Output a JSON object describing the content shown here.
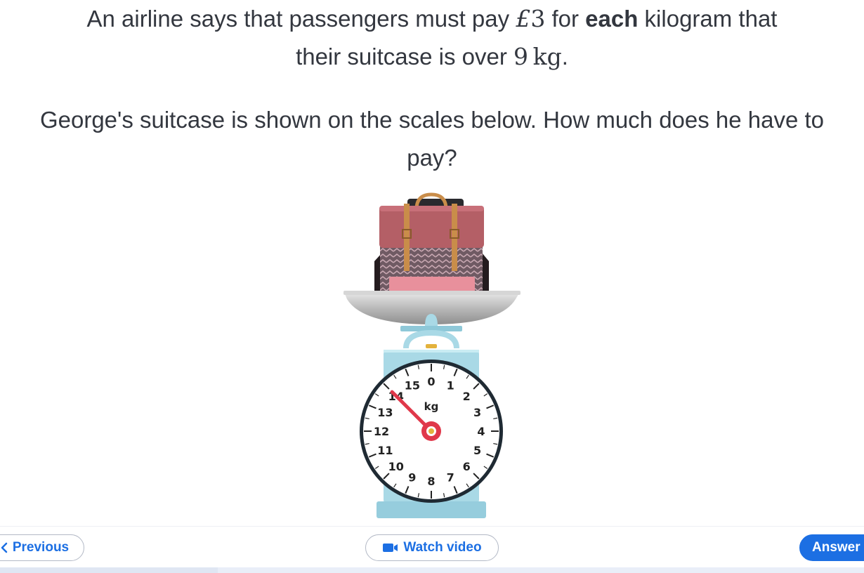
{
  "question": {
    "line1_pre": "An airline says that passengers must pay ",
    "price_symbol": "£",
    "price_value": "3",
    "line1_mid": " for ",
    "bold_word": "each",
    "line1_post": " kilogram that",
    "line2_pre": "their suitcase is over ",
    "limit_value": "9",
    "limit_unit": "kg",
    "line2_post": ".",
    "paragraph2": "George's suitcase is shown on the scales below. How much does he have to pay?"
  },
  "scale": {
    "unit_label": "kg",
    "min": 0,
    "max": 16,
    "ticks": [
      "0",
      "1",
      "2",
      "3",
      "4",
      "5",
      "6",
      "7",
      "8",
      "9",
      "10",
      "11",
      "12",
      "13",
      "14",
      "15"
    ],
    "reading_kg": 14
  },
  "nav": {
    "previous_label": "Previous",
    "video_label": "Watch video",
    "answer_label": "Answer"
  },
  "colors": {
    "accent": "#1c6fe3",
    "scale_body": "#a9d9e6",
    "needle": "#e0384a",
    "suitcase": "#b85c64"
  }
}
